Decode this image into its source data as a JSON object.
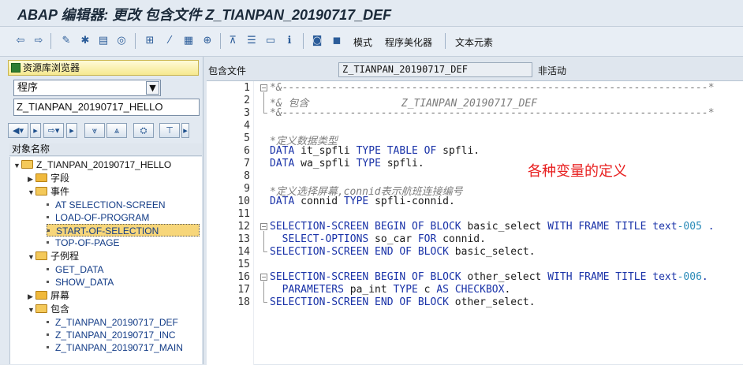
{
  "window": {
    "title": "ABAP 编辑器: 更改 包含文件 Z_TIANPAN_20190717_DEF"
  },
  "toolbar": {
    "icons": [
      "back-icon",
      "forward-icon",
      "display-change-icon",
      "activate-icon",
      "other-object-icon",
      "where-used-icon",
      "check-icon",
      "edit-icon",
      "test-icon",
      "hierarchy-icon",
      "stack-icon",
      "window-icon",
      "info-icon",
      "pattern-icon",
      "pretty-printer-icon"
    ],
    "pattern_label": "模式",
    "pretty_printer_label": "程序美化器",
    "text_elements_label": "文本元素"
  },
  "left": {
    "repo_browser_label": "资源库浏览器",
    "object_type": "程序",
    "object_name": "Z_TIANPAN_20190717_HELLO",
    "tree_header": "对象名称",
    "tree": {
      "root": "Z_TIANPAN_20190717_HELLO",
      "fields": "字段",
      "events": "事件",
      "event_items": [
        "AT SELECTION-SCREEN",
        "LOAD-OF-PROGRAM",
        "START-OF-SELECTION",
        "TOP-OF-PAGE"
      ],
      "subroutines": "子例程",
      "subroutine_items": [
        "GET_DATA",
        "SHOW_DATA"
      ],
      "screens": "屏幕",
      "includes": "包含",
      "include_items": [
        "Z_TIANPAN_20190717_DEF",
        "Z_TIANPAN_20190717_INC",
        "Z_TIANPAN_20190717_MAIN"
      ]
    }
  },
  "editor": {
    "include_label": "包含文件",
    "include_name": "Z_TIANPAN_20190717_DEF",
    "status": "非活动",
    "line_numbers": [
      "1",
      "2",
      "3",
      "4",
      "5",
      "6",
      "7",
      "8",
      "9",
      "10",
      "11",
      "12",
      "13",
      "14",
      "15",
      "16",
      "17",
      "18"
    ],
    "annotation": "各种变量的定义",
    "lines": {
      "l1": "*&---------------------------------------------------------------------*",
      "l2": "*& 包含               Z_TIANPAN_20190717_DEF",
      "l3": "*&---------------------------------------------------------------------*",
      "l5": "*定义数据类型",
      "l6a": "DATA",
      "l6b": " it_spfli ",
      "l6c": "TYPE TABLE OF",
      "l6d": " spfli.",
      "l7a": "DATA",
      "l7b": " wa_spfli ",
      "l7c": "TYPE",
      "l7d": " spfli.",
      "l9": "*定义选择屏幕,connid表示航班连接编号",
      "l10a": "DATA",
      "l10b": " connid ",
      "l10c": "TYPE",
      "l10d": " spfli-connid.",
      "l12a": "SELECTION-SCREEN BEGIN OF BLOCK",
      "l12b": " basic_select ",
      "l12c": "WITH FRAME TITLE",
      "l12d": " text",
      "l12e": "-005",
      "l12f": " .",
      "l13a": "  SELECT-OPTIONS",
      "l13b": " so_car ",
      "l13c": "FOR",
      "l13d": " connid.",
      "l14a": "SELECTION-SCREEN END OF BLOCK",
      "l14b": " basic_select.",
      "l16a": "SELECTION-SCREEN BEGIN OF BLOCK",
      "l16b": " other_select ",
      "l16c": "WITH FRAME TITLE",
      "l16d": " text",
      "l16e": "-006",
      "l16f": ".",
      "l17a": "  PARAMETERS",
      "l17b": " pa_int ",
      "l17c": "TYPE",
      "l17d": " c ",
      "l17e": "AS CHECKBOX",
      "l17f": ".",
      "l18a": "SELECTION-SCREEN END OF BLOCK",
      "l18b": " other_select."
    }
  }
}
